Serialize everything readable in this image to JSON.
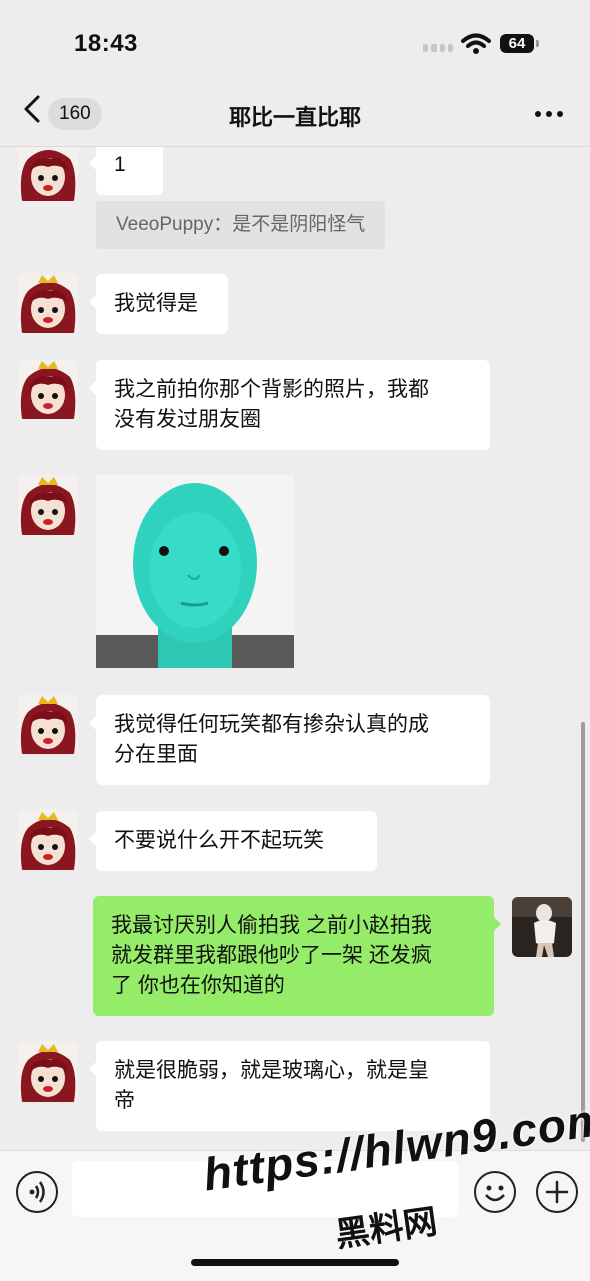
{
  "status_bar": {
    "time": "18:43",
    "battery": "64"
  },
  "nav": {
    "unread_count": "160",
    "title": "耶比一直比耶"
  },
  "messages": {
    "m1": "1",
    "quote": "VeeoPuppy：是不是阴阳怪气",
    "m2": "我觉得是",
    "m3": "我之前拍你那个背影的照片，我都\n没有发过朋友圈",
    "m5": "我觉得任何玩笑都有掺杂认真的成\n分在里面",
    "m6": "不要说什么开不起玩笑",
    "m7": "我最讨厌别人偷拍我 之前小赵拍我\n就发群里我都跟他吵了一架 还发疯\n了 你也在你知道的",
    "m8": "就是很脆弱，就是玻璃心，就是皇\n帝"
  },
  "watermark": {
    "url": "https://hlwn9.com",
    "cn": "黑料网"
  },
  "icons": {
    "back": "chevron-left-icon",
    "more": "more-dots-icon",
    "voice": "voice-icon",
    "emoji": "emoji-icon",
    "plus": "plus-icon",
    "wifi": "wifi-icon"
  },
  "colors": {
    "my_bubble": "#95ec69",
    "their_bubble": "#ffffff",
    "background": "#ededed"
  }
}
